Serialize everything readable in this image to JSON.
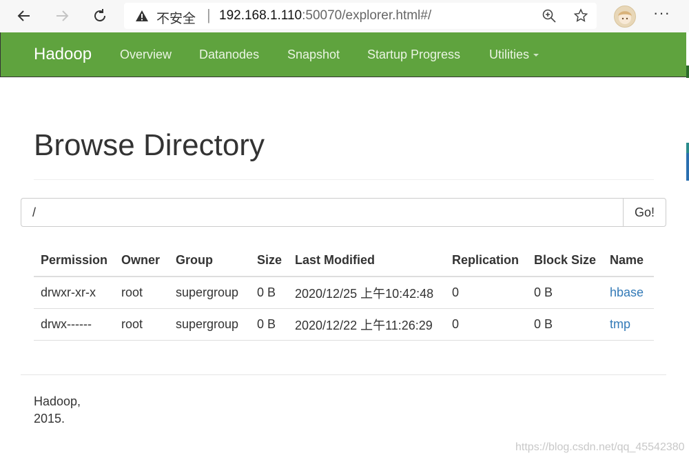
{
  "browser": {
    "security_label": "不安全",
    "url_host": "192.168.1.110",
    "url_rest": ":50070/explorer.html#/",
    "icons": [
      "back-icon",
      "forward-icon",
      "refresh-icon",
      "warning-icon",
      "zoom-icon",
      "favorite-star-icon",
      "avatar",
      "more-icon"
    ]
  },
  "navbar": {
    "brand": "Hadoop",
    "links": [
      "Overview",
      "Datanodes",
      "Snapshot",
      "Startup Progress",
      "Utilities"
    ],
    "color": "#5fa33e"
  },
  "page": {
    "title": "Browse Directory"
  },
  "path": {
    "value": "/",
    "go_label": "Go!"
  },
  "table": {
    "headers": [
      "Permission",
      "Owner",
      "Group",
      "Size",
      "Last Modified",
      "Replication",
      "Block Size",
      "Name"
    ],
    "rows": [
      {
        "permission": "drwxr-xr-x",
        "owner": "root",
        "group": "supergroup",
        "size": "0 B",
        "modified": "2020/12/25 上午10:42:48",
        "replication": "0",
        "block_size": "0 B",
        "name": "hbase"
      },
      {
        "permission": "drwx------",
        "owner": "root",
        "group": "supergroup",
        "size": "0 B",
        "modified": "2020/12/22 上午11:26:29",
        "replication": "0",
        "block_size": "0 B",
        "name": "tmp"
      }
    ],
    "link_color": "#337ab7"
  },
  "footer": {
    "line1": "Hadoop,",
    "line2": "2015."
  },
  "watermark": "https://blog.csdn.net/qq_45542380"
}
